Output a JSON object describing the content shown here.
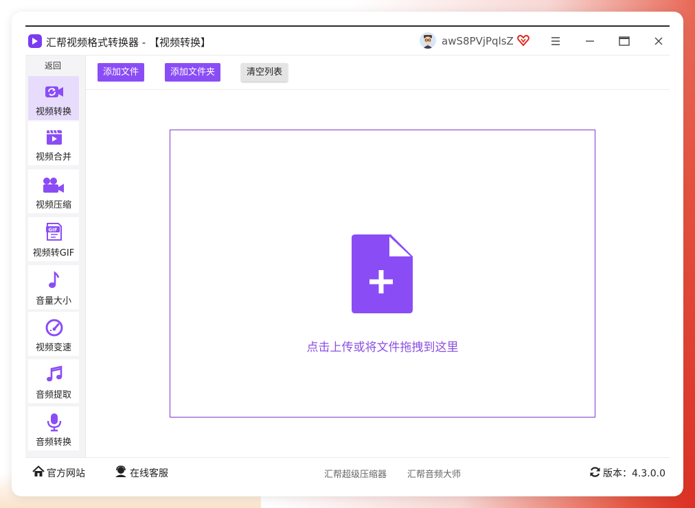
{
  "window": {
    "title": "汇帮视频格式转换器 - 【视频转换】",
    "username": "awS8PVjPqlsZ"
  },
  "sidebar": {
    "back_label": "返回",
    "items": [
      {
        "label": "视频转换",
        "icon": "video-convert-icon",
        "active": true
      },
      {
        "label": "视频合并",
        "icon": "video-merge-icon"
      },
      {
        "label": "视频压缩",
        "icon": "video-compress-icon"
      },
      {
        "label": "视频转GIF",
        "icon": "gif-icon"
      },
      {
        "label": "音量大小",
        "icon": "music-note-icon"
      },
      {
        "label": "视频变速",
        "icon": "speedometer-icon"
      },
      {
        "label": "音频提取",
        "icon": "music-notes-icon"
      },
      {
        "label": "音频转换",
        "icon": "microphone-icon"
      }
    ]
  },
  "toolbar": {
    "add_file": "添加文件",
    "add_folder": "添加文件夹",
    "clear_list": "清空列表"
  },
  "dropzone": {
    "text": "点击上传或将文件拖拽到这里"
  },
  "footer": {
    "website": "官方网站",
    "support": "在线客服",
    "link1": "汇帮超级压缩器",
    "link2": "汇帮音频大师",
    "version": "版本：4.3.0.0"
  },
  "colors": {
    "accent": "#8a4df5",
    "accent_light": "#e7dcfb",
    "border_purple": "#7b3cc8"
  }
}
